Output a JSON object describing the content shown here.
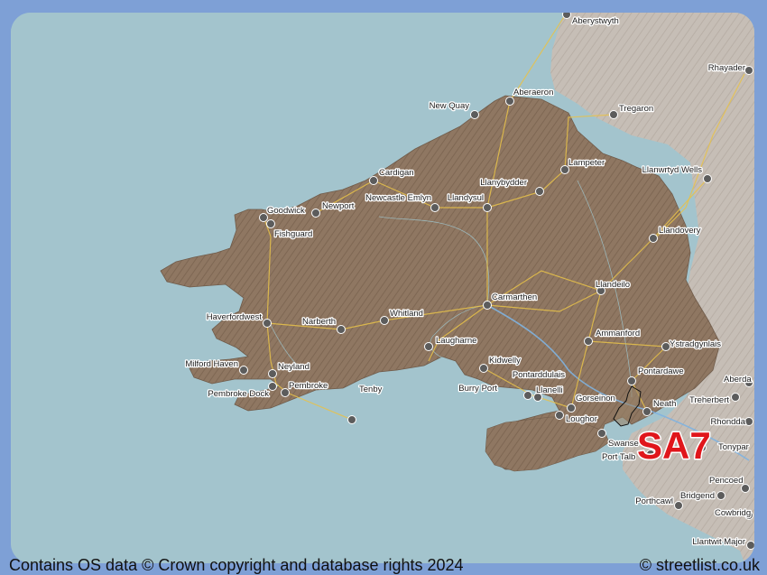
{
  "map": {
    "district": "SA7",
    "colors": {
      "sea": "#a3c4cd",
      "district_area": "#8f7762",
      "outside_land": "#c9c0b8",
      "frame": "#7ea0d6",
      "district_label": "#e0161b"
    },
    "places": [
      {
        "id": "aberystwyth",
        "name": "Aberystwyth"
      },
      {
        "id": "rhayader",
        "name": "Rhayader"
      },
      {
        "id": "aberaeron",
        "name": "Aberaeron"
      },
      {
        "id": "new-quay",
        "name": "New Quay"
      },
      {
        "id": "tregaron",
        "name": "Tregaron"
      },
      {
        "id": "lampeter",
        "name": "Lampeter"
      },
      {
        "id": "cardigan",
        "name": "Cardigan"
      },
      {
        "id": "llanwrtyd-wells",
        "name": "Llanwrtyd Wells"
      },
      {
        "id": "llanybydder",
        "name": "Llanybydder"
      },
      {
        "id": "newcastle-emlyn",
        "name": "Newcastle Emlyn"
      },
      {
        "id": "goodwick",
        "name": "Goodwick"
      },
      {
        "id": "newport",
        "name": "Newport"
      },
      {
        "id": "llandysul",
        "name": "Llandysul"
      },
      {
        "id": "fishguard",
        "name": "Fishguard"
      },
      {
        "id": "llandovery",
        "name": "Llandovery"
      },
      {
        "id": "llandeilo",
        "name": "Llandeilo"
      },
      {
        "id": "carmarthen",
        "name": "Carmarthen"
      },
      {
        "id": "haverfordwest",
        "name": "Haverfordwest"
      },
      {
        "id": "whitland",
        "name": "Whitland"
      },
      {
        "id": "narberth",
        "name": "Narberth"
      },
      {
        "id": "ammanford",
        "name": "Ammanford"
      },
      {
        "id": "laugharne",
        "name": "Laugharne"
      },
      {
        "id": "ystradgynlais",
        "name": "Ystradgynlais"
      },
      {
        "id": "milford-haven",
        "name": "Milford Haven"
      },
      {
        "id": "kidwelly",
        "name": "Kidwelly"
      },
      {
        "id": "neyland",
        "name": "Neyland"
      },
      {
        "id": "pontardawe",
        "name": "Pontardawe"
      },
      {
        "id": "pontarddulais",
        "name": "Pontarddulais"
      },
      {
        "id": "aberdare",
        "name": "Aberda"
      },
      {
        "id": "pembroke-dock",
        "name": "Pembroke Dock"
      },
      {
        "id": "pembroke",
        "name": "Pembroke"
      },
      {
        "id": "tenby",
        "name": "Tenby"
      },
      {
        "id": "burry-port",
        "name": "Burry Port"
      },
      {
        "id": "llanelli",
        "name": "Llanelli"
      },
      {
        "id": "gorseinon",
        "name": "Gorseinon"
      },
      {
        "id": "treherbert",
        "name": "Treherbert"
      },
      {
        "id": "neath",
        "name": "Neath"
      },
      {
        "id": "loughor",
        "name": "Loughor"
      },
      {
        "id": "rhondda",
        "name": "Rhondda"
      },
      {
        "id": "swansea",
        "name": "Swanse"
      },
      {
        "id": "tonypandy",
        "name": "Tonypar"
      },
      {
        "id": "port-talbot",
        "name": "Port Talb"
      },
      {
        "id": "pencoed",
        "name": "Pencoed"
      },
      {
        "id": "bridgend",
        "name": "Bridgend"
      },
      {
        "id": "porthcawl",
        "name": "Porthcawl"
      },
      {
        "id": "cowbridge",
        "name": "Cowbridg"
      },
      {
        "id": "llantwit-major",
        "name": "Llantwit Major"
      }
    ]
  },
  "footer": {
    "attribution": "Contains OS data © Crown copyright and database rights 2024",
    "brand": "© streetlist.co.uk"
  }
}
